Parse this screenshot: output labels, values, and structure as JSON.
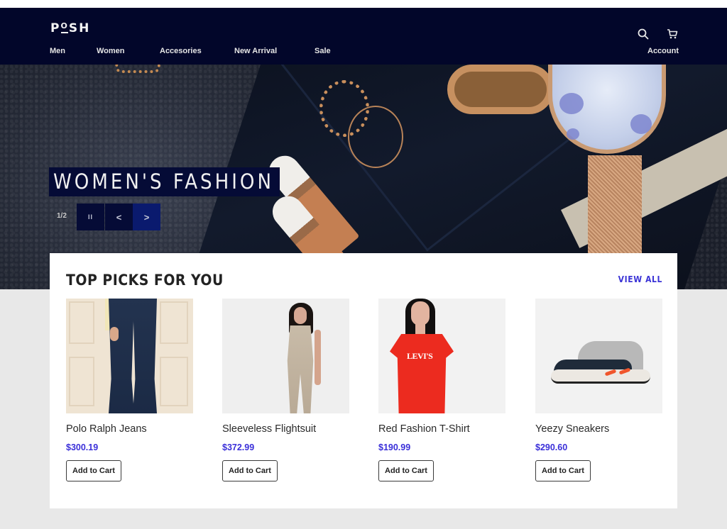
{
  "brand": {
    "logo_left": "P",
    "logo_o": "O",
    "logo_right": "SH"
  },
  "nav": {
    "links": [
      "Men",
      "Women",
      "Accesories",
      "New Arrival",
      "Sale"
    ],
    "account": "Account",
    "icons": [
      "search-icon",
      "cart-icon"
    ]
  },
  "hero": {
    "title": "WOMEN'S FASHION",
    "slide_counter": "1/2",
    "current_slide": 1,
    "total_slides": 2,
    "controls": {
      "pause": "II",
      "prev": "<",
      "next": ">"
    }
  },
  "top_picks": {
    "title": "TOP PICKS FOR YOU",
    "view_all": "VIEW ALL",
    "products": [
      {
        "name": "Polo Ralph Jeans",
        "price": "$300.19",
        "button": "Add to Cart",
        "image": "flared-denim-jeans"
      },
      {
        "name": "Sleeveless Flightsuit",
        "price": "$372.99",
        "button": "Add to Cart",
        "image": "beige-sleeveless-jumpsuit"
      },
      {
        "name": "Red Fashion T-Shirt",
        "price": "$190.99",
        "button": "Add to Cart",
        "image": "red-levis-tshirt",
        "image_text": "LEVI'S"
      },
      {
        "name": "Yeezy Sneakers",
        "price": "$290.60",
        "button": "Add to Cart",
        "image": "grey-chunky-sneaker"
      }
    ]
  },
  "colors": {
    "nav_bg": "#02062a",
    "hero_label_bg": "#050b36",
    "next_button_bg": "#0a1a6e",
    "accent": "#3a2fd9",
    "page_bg": "#e8e8e8"
  }
}
